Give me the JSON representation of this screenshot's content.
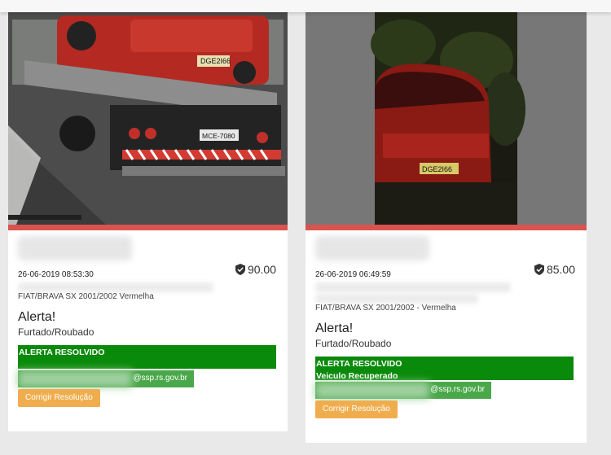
{
  "cards": [
    {
      "datetime": "26-06-2019 08:53:30",
      "score": "90.00",
      "vehicle": "FIAT/BRAVA SX 2001/2002 Vermelha",
      "alert_title": "Alerta!",
      "alert_subtitle": "Furtado/Roubado",
      "status_lines": [
        "ALERTA RESOLVIDO",
        ""
      ],
      "email_suffix": "@ssp.rs.gov.br",
      "fix_button": "Corrigir Resolução",
      "photo": {
        "plate_car": "DGE2I66",
        "plate_truck": "MCE-7080"
      }
    },
    {
      "datetime": "26-06-2019 06:49:59",
      "score": "85.00",
      "vehicle": "FIAT/BRAVA SX 2001/2002 - Vermelha",
      "alert_title": "Alerta!",
      "alert_subtitle": "Furtado/Roubado",
      "status_lines": [
        "ALERTA RESOLVIDO",
        "Veiculo Recuperado"
      ],
      "email_suffix": "@ssp.rs.gov.br",
      "fix_button": "Corrigir Resolução",
      "photo": {
        "plate_car": "DGE2I66"
      }
    }
  ],
  "colors": {
    "status_bar": "#d9534f",
    "resolved": "#0a8a0a",
    "email": "#4aa84a",
    "fix_button": "#f0ad4e"
  },
  "icons": {
    "score": "shield-check-icon"
  }
}
